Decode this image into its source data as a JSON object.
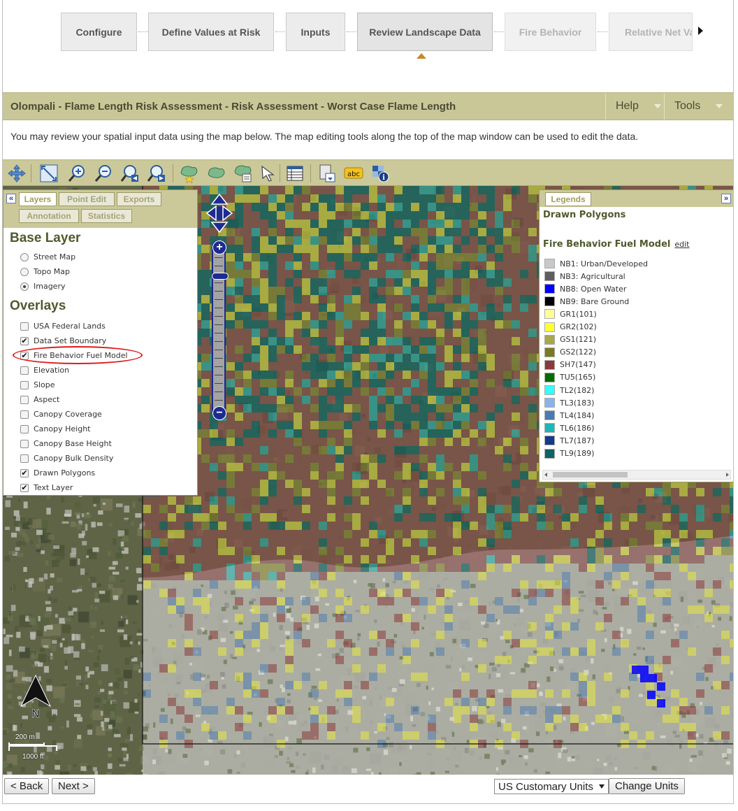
{
  "wizard": {
    "steps": [
      {
        "label": "Configure",
        "state": "done"
      },
      {
        "label": "Define Values at Risk",
        "state": "done"
      },
      {
        "label": "Inputs",
        "state": "done"
      },
      {
        "label": "Review Landscape Data",
        "state": "current"
      },
      {
        "label": "Fire Behavior",
        "state": "disabled"
      },
      {
        "label": "Relative Net Va",
        "state": "disabled"
      }
    ]
  },
  "header": {
    "title": "Olompali - Flame Length Risk Assessment - Risk Assessment - Worst Case Flame Length",
    "help_label": "Help",
    "tools_label": "Tools"
  },
  "intro_text": "You may review your spatial input data using the map below. The map editing tools along the top of the map window can be used to edit the data.",
  "toolbar": {
    "tools": [
      "pan-icon",
      "zoom-extent-icon",
      "zoom-in-icon",
      "zoom-out-icon",
      "zoom-previous-icon",
      "zoom-next-icon",
      "draw-polygon-icon",
      "edit-polygon-icon",
      "polygon-attributes-icon",
      "select-arrow-icon",
      "attribute-table-icon",
      "export-icon",
      "text-label-icon",
      "identify-icon"
    ]
  },
  "layers_panel": {
    "tabs": [
      "Layers",
      "Point Edit",
      "Exports",
      "Annotation",
      "Statistics"
    ],
    "active_tab": "Layers",
    "collapse_glyph": "«",
    "base_layer_heading": "Base Layer",
    "base_layers": [
      {
        "label": "Street Map",
        "selected": false
      },
      {
        "label": "Topo Map",
        "selected": false
      },
      {
        "label": "Imagery",
        "selected": true
      }
    ],
    "overlays_heading": "Overlays",
    "overlays": [
      {
        "label": "USA Federal Lands",
        "checked": false
      },
      {
        "label": "Data Set Boundary",
        "checked": true
      },
      {
        "label": "Fire Behavior Fuel Model",
        "checked": true
      },
      {
        "label": "Elevation",
        "checked": false
      },
      {
        "label": "Slope",
        "checked": false
      },
      {
        "label": "Aspect",
        "checked": false
      },
      {
        "label": "Canopy Coverage",
        "checked": false
      },
      {
        "label": "Canopy Height",
        "checked": false
      },
      {
        "label": "Canopy Base Height",
        "checked": false
      },
      {
        "label": "Canopy Bulk Density",
        "checked": false
      },
      {
        "label": "Drawn Polygons",
        "checked": true
      },
      {
        "label": "Text Layer",
        "checked": true
      }
    ]
  },
  "legend_panel": {
    "tab": "Legends",
    "expand_glyph": "»",
    "drawn_polygons_label": "Drawn Polygons",
    "fuel_model_label": "Fire Behavior Fuel Model",
    "edit_link": "edit",
    "items": [
      {
        "label": "NB1: Urban/Developed",
        "color": "#c8c8c8"
      },
      {
        "label": "NB3: Agricultural",
        "color": "#5e5e5e"
      },
      {
        "label": "NB8: Open Water",
        "color": "#0000ff"
      },
      {
        "label": "NB9: Bare Ground",
        "color": "#000000"
      },
      {
        "label": "GR1(101)",
        "color": "#ffff99"
      },
      {
        "label": "GR2(102)",
        "color": "#ffff33"
      },
      {
        "label": "GS1(121)",
        "color": "#a8a84a"
      },
      {
        "label": "GS2(122)",
        "color": "#7a7a1e"
      },
      {
        "label": "SH7(147)",
        "color": "#8a3a3a"
      },
      {
        "label": "TU5(165)",
        "color": "#006b00"
      },
      {
        "label": "TL2(182)",
        "color": "#33ffff"
      },
      {
        "label": "TL3(183)",
        "color": "#8ab4e8"
      },
      {
        "label": "TL4(184)",
        "color": "#4a7ab0"
      },
      {
        "label": "TL6(186)",
        "color": "#1ab8b8"
      },
      {
        "label": "TL7(187)",
        "color": "#123c8a"
      },
      {
        "label": "TL9(189)",
        "color": "#0e6363"
      }
    ]
  },
  "map": {
    "north_label": "N",
    "scale_metric": "200 m",
    "scale_imperial": "1000 ft",
    "zoom_in_glyph": "+",
    "zoom_out_glyph": "−"
  },
  "footer": {
    "back_label": "< Back",
    "next_label": "Next >",
    "units_value": "US Customary Units",
    "change_units_label": "Change Units"
  }
}
